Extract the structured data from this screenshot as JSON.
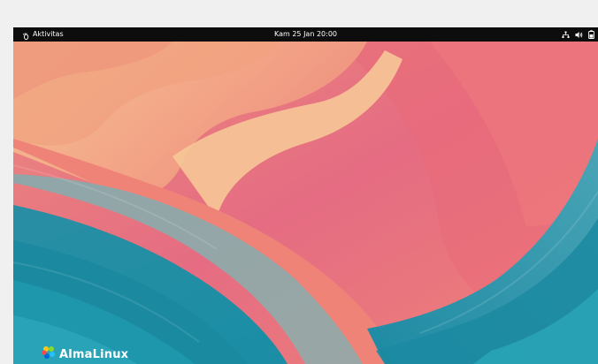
{
  "topbar": {
    "activities_label": "Aktivitas",
    "activities_icon": "gnome-foot-icon",
    "clock": "Kam 25 Jan  20:00",
    "tray_icons": [
      "network-icon",
      "volume-icon",
      "battery-icon"
    ]
  },
  "desktop": {
    "brand_name": "AlmaLinux",
    "brand_icon": "almalinux-logo-icon"
  },
  "colors": {
    "topbar_bg": "#0d0d0d",
    "wallpaper_pink": "#e97a7f",
    "wallpaper_teal": "#1f94a8",
    "wallpaper_peach": "#f4b889",
    "frame_bg": "#f0f0f0"
  }
}
